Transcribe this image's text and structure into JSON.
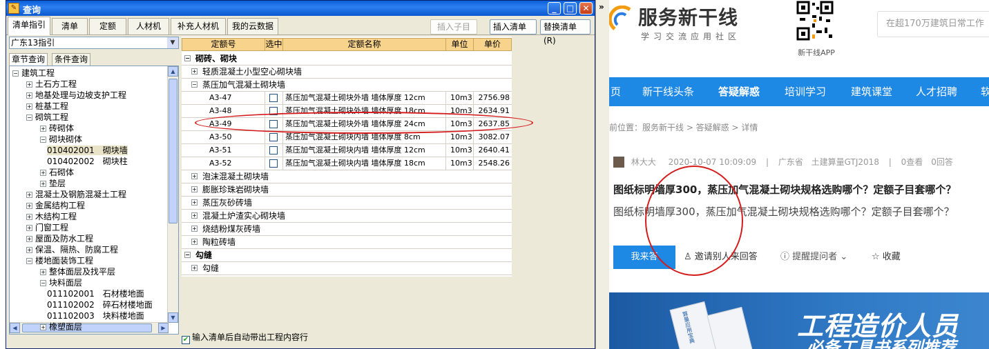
{
  "dialog": {
    "title": "查询",
    "tabs": [
      "清单指引",
      "清单",
      "定额",
      "人材机",
      "补充人材机",
      "我的云数据"
    ],
    "buttons": {
      "insert_child": "插入子目",
      "insert_list": "插入清单(I)",
      "replace_list": "替换清单(R)"
    },
    "combo_value": "广东13指引",
    "subtabs": [
      "章节查询",
      "条件查询"
    ],
    "tree": [
      {
        "label": "建筑工程",
        "level": 0,
        "exp": "−"
      },
      {
        "label": "土石方工程",
        "level": 1,
        "exp": "+"
      },
      {
        "label": "地基处理与边坡支护工程",
        "level": 1,
        "exp": "+"
      },
      {
        "label": "桩基工程",
        "level": 1,
        "exp": "+"
      },
      {
        "label": "砌筑工程",
        "level": 1,
        "exp": "−"
      },
      {
        "label": "砖砌体",
        "level": 2,
        "exp": "+"
      },
      {
        "label": "砌块砌体",
        "level": 2,
        "exp": "−"
      },
      {
        "label": "010402001　砌块墙",
        "level": 3,
        "exp": "",
        "selected": true
      },
      {
        "label": "010402002　砌块柱",
        "level": 3,
        "exp": ""
      },
      {
        "label": "石砌体",
        "level": 2,
        "exp": "+"
      },
      {
        "label": "垫层",
        "level": 2,
        "exp": "+"
      },
      {
        "label": "混凝土及钢筋混凝土工程",
        "level": 1,
        "exp": "+"
      },
      {
        "label": "金属结构工程",
        "level": 1,
        "exp": "+"
      },
      {
        "label": "木结构工程",
        "level": 1,
        "exp": "+"
      },
      {
        "label": "门窗工程",
        "level": 1,
        "exp": "+"
      },
      {
        "label": "屋面及防水工程",
        "level": 1,
        "exp": "+"
      },
      {
        "label": "保温、隔热、防腐工程",
        "level": 1,
        "exp": "+"
      },
      {
        "label": "楼地面装饰工程",
        "level": 1,
        "exp": "−"
      },
      {
        "label": "整体面层及找平层",
        "level": 2,
        "exp": "+"
      },
      {
        "label": "块料面层",
        "level": 2,
        "exp": "−"
      },
      {
        "label": "011102001　石材楼地面",
        "level": 3,
        "exp": ""
      },
      {
        "label": "011102002　碎石材楼地面",
        "level": 3,
        "exp": ""
      },
      {
        "label": "011102003　块料楼地面",
        "level": 3,
        "exp": ""
      },
      {
        "label": "橡塑面层",
        "level": 2,
        "exp": "+"
      }
    ],
    "grid_headers": [
      "定额号",
      "选中",
      "定额名称",
      "单位",
      "单价"
    ],
    "grid_rows": [
      {
        "type": "group",
        "exp": "−",
        "label": "砌砖、砌块"
      },
      {
        "type": "sub",
        "exp": "+",
        "label": "轻质混凝土小型空心砌块墙"
      },
      {
        "type": "sub",
        "exp": "−",
        "label": "蒸压加气混凝土砌块墙"
      },
      {
        "type": "item",
        "code": "A3-47",
        "name": "蒸压加气混凝土砌块外墙 墙体厚度 12cm",
        "unit": "10m3",
        "price": "2756.98"
      },
      {
        "type": "item",
        "code": "A3-48",
        "name": "蒸压加气混凝土砌块外墙 墙体厚度 18cm",
        "unit": "10m3",
        "price": "2634.91"
      },
      {
        "type": "item",
        "code": "A3-49",
        "name": "蒸压加气混凝土砌块外墙 墙体厚度 24cm",
        "unit": "10m3",
        "price": "2637.85"
      },
      {
        "type": "item",
        "code": "A3-50",
        "name": "蒸压加气混凝土砌块内墙 墙体厚度 8cm",
        "unit": "10m3",
        "price": "3082.07"
      },
      {
        "type": "item",
        "code": "A3-51",
        "name": "蒸压加气混凝土砌块内墙 墙体厚度 12cm",
        "unit": "10m3",
        "price": "2640.41"
      },
      {
        "type": "item",
        "code": "A3-52",
        "name": "蒸压加气混凝土砌块内墙 墙体厚度 18cm",
        "unit": "10m3",
        "price": "2548.26"
      },
      {
        "type": "sub",
        "exp": "+",
        "label": "泡沫混凝土砌块墙"
      },
      {
        "type": "sub",
        "exp": "+",
        "label": "膨胀珍珠岩砌块墙"
      },
      {
        "type": "sub",
        "exp": "+",
        "label": "蒸压灰砂砖墙"
      },
      {
        "type": "sub",
        "exp": "+",
        "label": "混凝土炉渣实心砌块墙"
      },
      {
        "type": "sub",
        "exp": "+",
        "label": "烧结粉煤灰砖墙"
      },
      {
        "type": "sub",
        "exp": "+",
        "label": "陶粒砖墙"
      },
      {
        "type": "group",
        "exp": "−",
        "label": "勾缝"
      },
      {
        "type": "sub",
        "exp": "+",
        "label": "勾缝"
      }
    ],
    "auto_bring_label": "输入清单后自动带出工程内容行",
    "auto_bring_checked": true
  },
  "web": {
    "brand": "服务新干线",
    "tagline": "学习交流应用社区",
    "qr_label": "新干线APP",
    "search_placeholder": "在超170万建筑日常工作",
    "nav": [
      "页",
      "新干线头条",
      "答疑解惑",
      "培训学习",
      "建筑课堂",
      "人才招聘",
      "软"
    ],
    "nav_active": "答疑解惑",
    "breadcrumb": "前位置：服务新干线 > 答疑解惑 > 详情",
    "meta": {
      "user": "林大大",
      "date": "2020-10-07 10:09:09",
      "region": "广东省",
      "tags": "土建算量GTJ2018",
      "stats": "0查看　0回答"
    },
    "question_title": "图纸标明墙厚300，蒸压加气混凝土砌块规格选购哪个？定额子目套哪个？",
    "question_body": "图纸标明墙厚300，蒸压加气混凝土砌块规格选购哪个？定额子目套哪个？",
    "answer_button": "我来答",
    "invite": "邀请别人来回答",
    "remind": "提醒提问者",
    "favorite": "收藏",
    "banner_line1": "工程造价人员",
    "banner_line2": "必备工具书系列推荐",
    "book_title": "算量应用宝典"
  },
  "edge": {
    "chevron": "»"
  }
}
